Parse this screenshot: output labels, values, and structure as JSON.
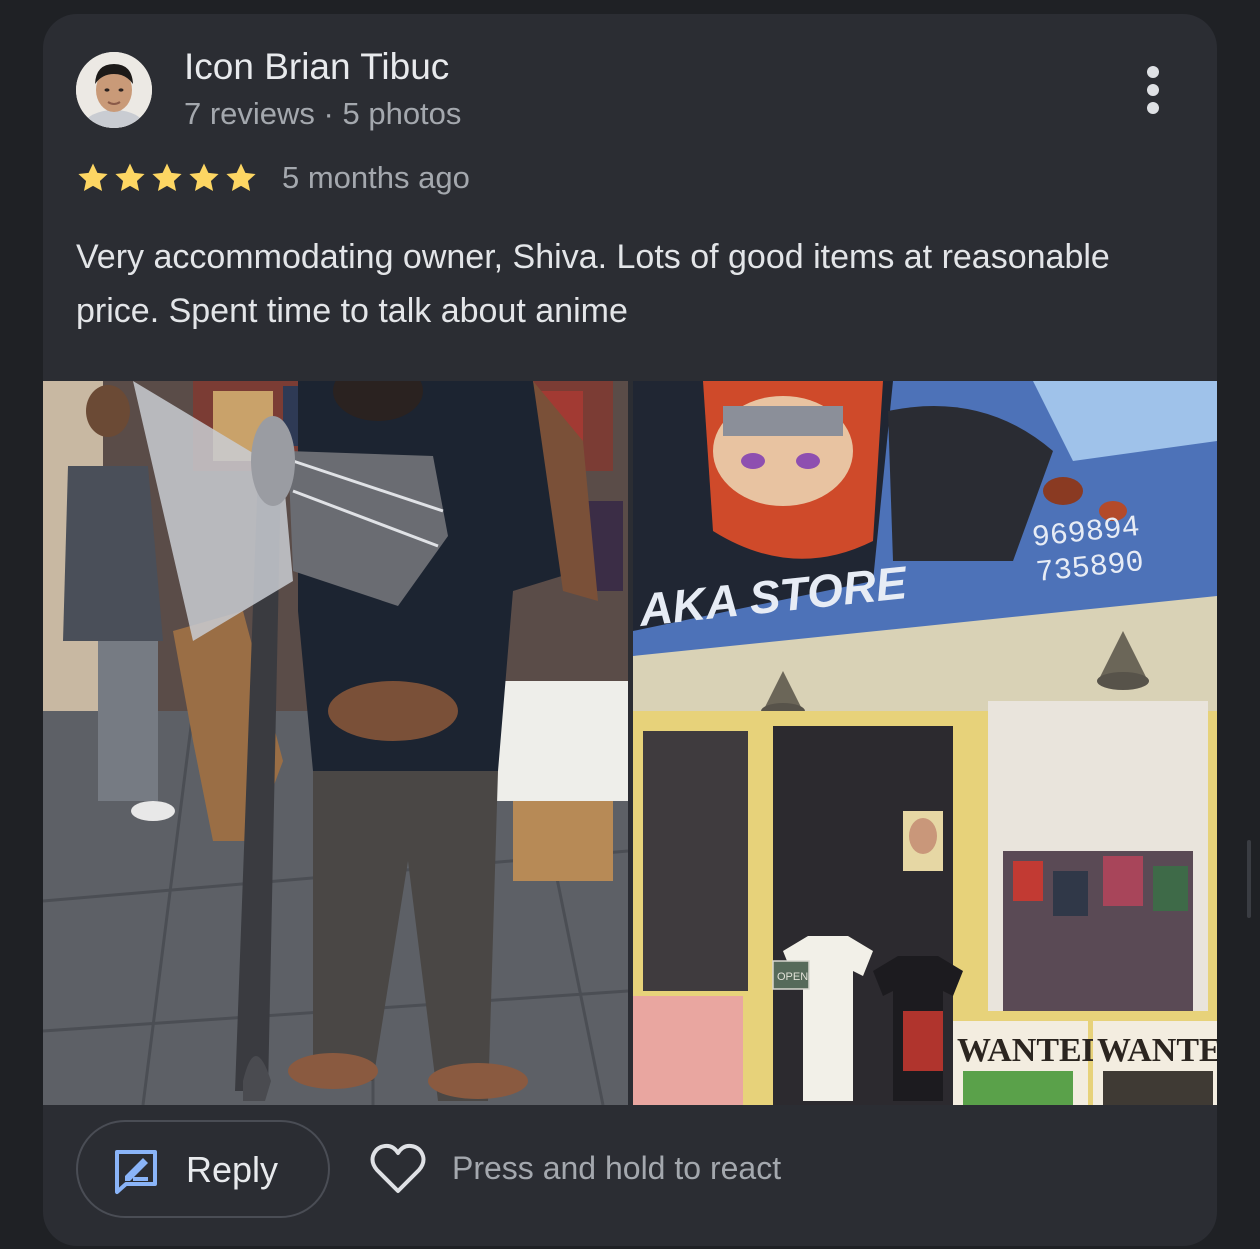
{
  "review": {
    "reviewer_name": "Icon Brian Tibuc",
    "reviewer_meta": "7 reviews · 5 photos",
    "rating": 5,
    "rating_max": 5,
    "time_ago": "5 months ago",
    "text": "Very accommodating owner, Shiva. Lots of good items at reasonable price. Spent time to talk about anime",
    "photos": [
      {
        "icon": "photo-man-with-axe"
      },
      {
        "icon": "photo-store-front"
      }
    ],
    "store_sign_text": "AKA STORE",
    "store_sign_number_1": "969894",
    "store_sign_number_2": "735890",
    "poster_text_1": "WANTED",
    "poster_text_2": "WANTEI",
    "sign_open": "OPEN"
  },
  "actions": {
    "reply_label": "Reply",
    "react_label": "Press and hold to react",
    "more_icon": "more-vert-icon",
    "reply_icon": "edit-square-icon",
    "react_icon": "heart-outline-icon"
  },
  "colors": {
    "background": "#1f2125",
    "card": "#2b2d33",
    "star": "#fdd663",
    "reply_icon": "#8ab4f8",
    "text_primary": "#e8eaed",
    "text_secondary": "#a4a8ae"
  }
}
